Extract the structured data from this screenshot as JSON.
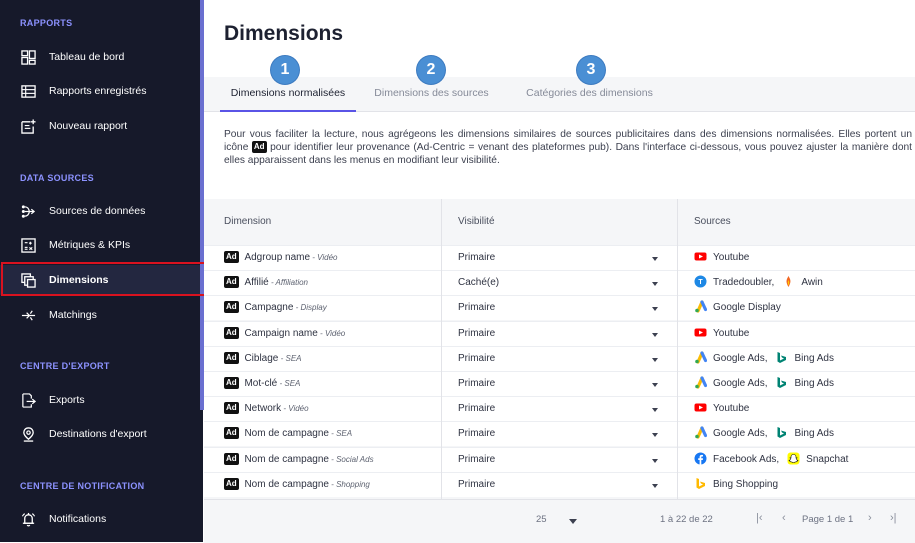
{
  "sidebar": {
    "sections": [
      {
        "title": "RAPPORTS"
      },
      {
        "title": "DATA SOURCES"
      },
      {
        "title": "CENTRE D'EXPORT"
      },
      {
        "title": "CENTRE DE NOTIFICATION"
      }
    ],
    "items": [
      {
        "label": "Tableau de bord",
        "icon": "dashboard-icon"
      },
      {
        "label": "Rapports enregistrés",
        "icon": "saved-reports-icon"
      },
      {
        "label": "Nouveau rapport",
        "icon": "new-report-icon"
      },
      {
        "label": "Sources de données",
        "icon": "data-sources-icon"
      },
      {
        "label": "Métriques & KPIs",
        "icon": "metrics-icon"
      },
      {
        "label": "Dimensions",
        "icon": "dimensions-icon",
        "active": true
      },
      {
        "label": "Matchings",
        "icon": "matchings-icon"
      },
      {
        "label": "Exports",
        "icon": "exports-icon"
      },
      {
        "label": "Destinations d'export",
        "icon": "location-pin-icon"
      },
      {
        "label": "Notifications",
        "icon": "bell-icon"
      }
    ]
  },
  "main": {
    "title": "Dimensions",
    "tabs": [
      {
        "label": "Dimensions normalisées",
        "active": true,
        "badge": "1"
      },
      {
        "label": "Dimensions des sources",
        "badge": "2"
      },
      {
        "label": "Catégories des dimensions",
        "badge": "3"
      }
    ],
    "intro": {
      "part1": "Pour vous faciliter la lecture, nous agrégeons les dimensions similaires de sources publicitaires dans des dimensions normalisées. Elles portent un icône",
      "badge": "Ad",
      "part2": "pour identifier leur provenance (Ad-Centric = venant des plateformes pub). Dans l'interface ci-dessous, vous pouvez ajuster la manière dont elles apparaissent dans les menus en modifiant leur visibilité."
    },
    "table": {
      "headers": {
        "dimension": "Dimension",
        "visibility": "Visibilité",
        "sources": "Sources"
      },
      "rows": [
        {
          "badge": "Ad",
          "name": "Adgroup name",
          "sep": " - ",
          "category": "Vidéo",
          "visibility": "Primaire",
          "sources": [
            {
              "name": "Youtube",
              "icon": "youtube-icon"
            }
          ]
        },
        {
          "badge": "Ad",
          "name": "Affilié",
          "sep": " - ",
          "category": "Affiliation",
          "visibility": "Caché(e)",
          "sources": [
            {
              "name": "Tradedoubler,",
              "icon": "tradedoubler-icon"
            },
            {
              "name": "Awin",
              "icon": "awin-icon"
            }
          ]
        },
        {
          "badge": "Ad",
          "name": "Campagne",
          "sep": " - ",
          "category": "Display",
          "visibility": "Primaire",
          "sources": [
            {
              "name": "Google Display",
              "icon": "google-ads-icon"
            }
          ]
        },
        {
          "badge": "Ad",
          "name": "Campaign name",
          "sep": " - ",
          "category": "Vidéo",
          "visibility": "Primaire",
          "sources": [
            {
              "name": "Youtube",
              "icon": "youtube-icon"
            }
          ]
        },
        {
          "badge": "Ad",
          "name": "Ciblage",
          "sep": " - ",
          "category": "SEA",
          "visibility": "Primaire",
          "sources": [
            {
              "name": "Google Ads,",
              "icon": "google-ads-icon"
            },
            {
              "name": "Bing Ads",
              "icon": "bing-icon"
            }
          ]
        },
        {
          "badge": "Ad",
          "name": "Mot-clé",
          "sep": " - ",
          "category": "SEA",
          "visibility": "Primaire",
          "sources": [
            {
              "name": "Google Ads,",
              "icon": "google-ads-icon"
            },
            {
              "name": "Bing Ads",
              "icon": "bing-icon"
            }
          ]
        },
        {
          "badge": "Ad",
          "name": "Network",
          "sep": " - ",
          "category": "Vidéo",
          "visibility": "Primaire",
          "sources": [
            {
              "name": "Youtube",
              "icon": "youtube-icon"
            }
          ]
        },
        {
          "badge": "Ad",
          "name": "Nom de campagne",
          "sep": " - ",
          "category": "SEA",
          "visibility": "Primaire",
          "sources": [
            {
              "name": "Google Ads,",
              "icon": "google-ads-icon"
            },
            {
              "name": "Bing Ads",
              "icon": "bing-icon"
            }
          ]
        },
        {
          "badge": "Ad",
          "name": "Nom de campagne",
          "sep": " - ",
          "category": "Social Ads",
          "visibility": "Primaire",
          "sources": [
            {
              "name": "Facebook Ads,",
              "icon": "facebook-icon"
            },
            {
              "name": "Snapchat",
              "icon": "snapchat-icon"
            }
          ]
        },
        {
          "badge": "Ad",
          "name": "Nom de campagne",
          "sep": " - ",
          "category": "Shopping",
          "visibility": "Primaire",
          "sources": [
            {
              "name": "Bing Shopping",
              "icon": "bing-shopping-icon"
            }
          ]
        }
      ]
    },
    "pagination": {
      "per_page": "25",
      "range": "1 à 22 de 22",
      "page": "Page 1 de 1",
      "first": "|‹",
      "prev": "‹",
      "next": "›",
      "last": "›|"
    }
  }
}
